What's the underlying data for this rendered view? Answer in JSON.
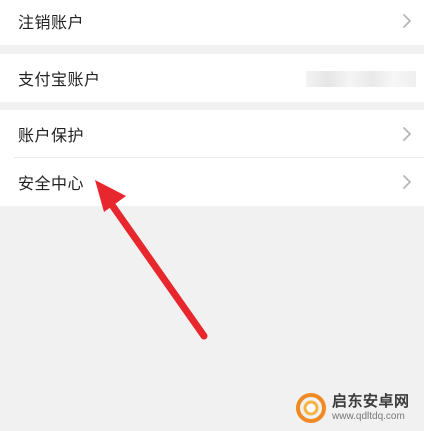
{
  "rows": {
    "cancel_account": "注销账户",
    "alipay_account": "支付宝账户",
    "account_protection": "账户保护",
    "security_center": "安全中心"
  },
  "icons": {
    "chevron": "chevron-right-icon",
    "arrow": "red-arrow-annotation",
    "logo": "watermark-logo"
  },
  "colors": {
    "background": "#f1f1f1",
    "card": "#ffffff",
    "arrow": "#e8262d",
    "chevron": "#b5b5b5"
  },
  "watermark": {
    "name": "启东安卓网",
    "url": "www.qdltdq.com"
  }
}
